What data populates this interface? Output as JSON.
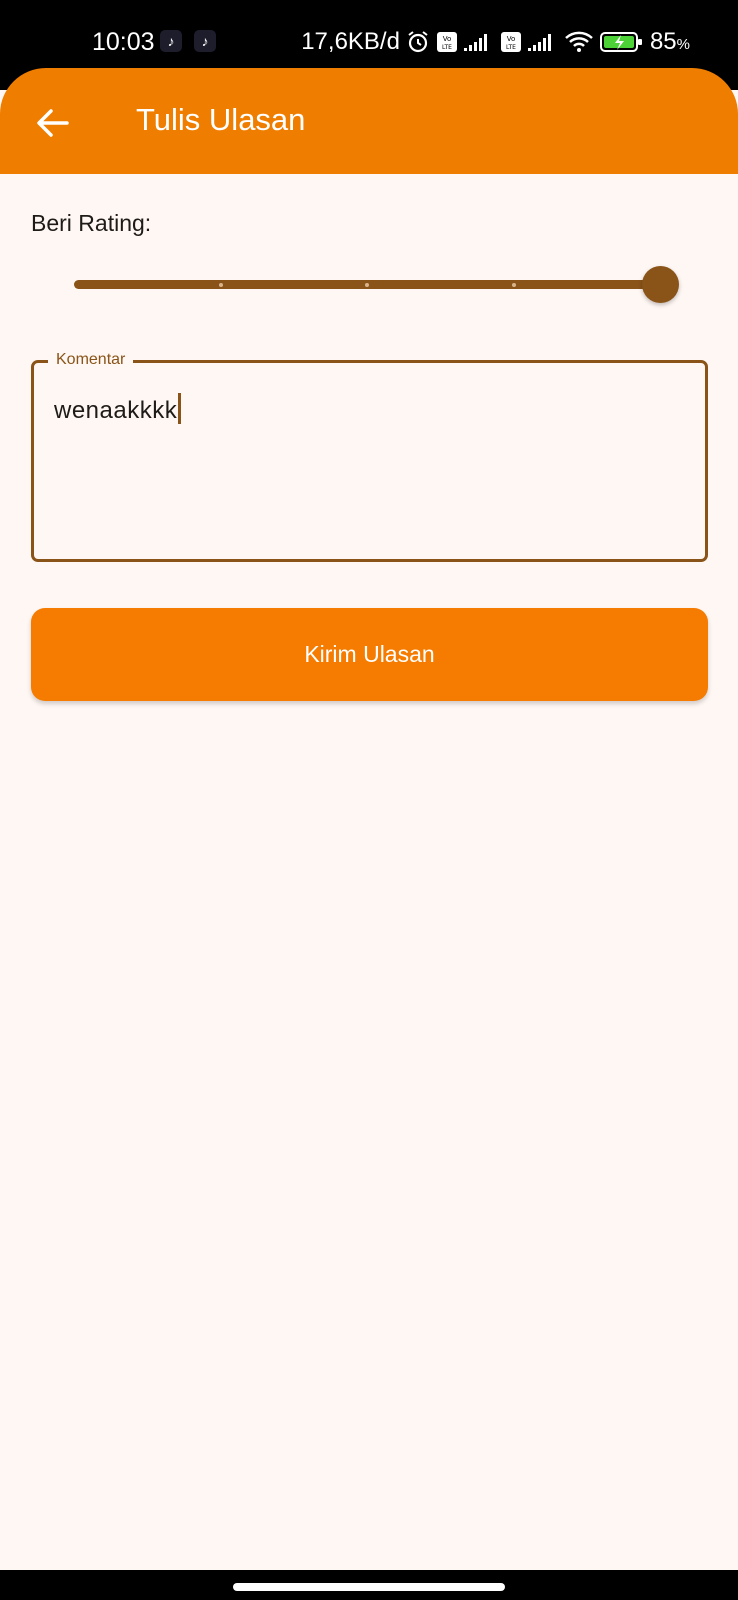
{
  "status_bar": {
    "time": "10:03",
    "net_speed": "17,6KB/d",
    "battery_percent": "85",
    "battery_unit": "%",
    "icons": [
      "tiktok-icon",
      "tiktok-icon",
      "alarm-icon",
      "volte-icon",
      "signal-icon",
      "volte-icon",
      "signal-icon",
      "wifi-icon",
      "battery-charging-icon"
    ]
  },
  "app_bar": {
    "title": "Tulis Ulasan",
    "back_icon": "arrow-left-icon"
  },
  "rating": {
    "label": "Beri Rating:",
    "value": 5,
    "min": 1,
    "max": 5
  },
  "comment": {
    "label": "Komentar",
    "value": "wenaakkkk"
  },
  "submit": {
    "label": "Kirim Ulasan"
  },
  "colors": {
    "primary": "#ef7d00",
    "button": "#f57c00",
    "accent_brown": "#8a5418",
    "background": "#fff7f3"
  }
}
